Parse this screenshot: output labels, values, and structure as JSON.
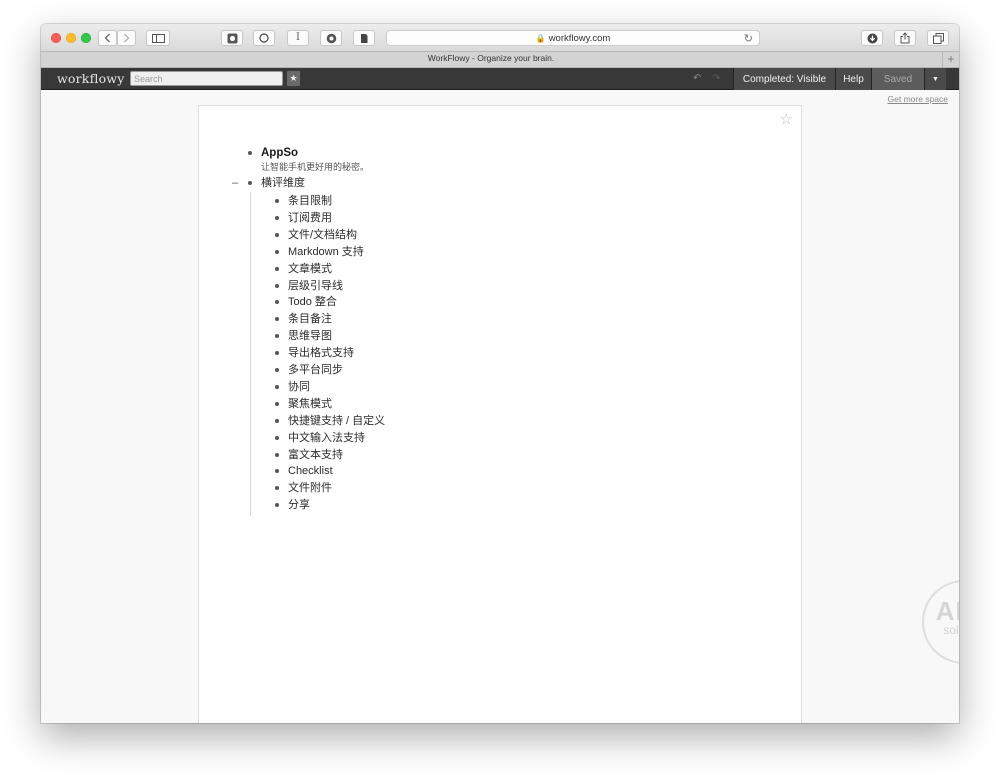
{
  "browser": {
    "url": "workflowy.com",
    "tab_title": "WorkFlowy - Organize your brain."
  },
  "workflowy": {
    "logo": "workflowy",
    "search_placeholder": "Search",
    "completed_label": "Completed: Visible",
    "help_label": "Help",
    "saved_label": "Saved",
    "more_space_link": "Get more space"
  },
  "outline": {
    "root_title": "AppSo",
    "root_note": "让智能手机更好用的秘密。",
    "group_title": "横评维度",
    "children": [
      "条目限制",
      "订阅费用",
      "文件/文档结构",
      "Markdown 支持",
      "文章模式",
      "层级引导线",
      "Todo 整合",
      "条目备注",
      "思维导图",
      "导出格式支持",
      "多平台同步",
      "协同",
      "聚焦模式",
      "快捷键支持 / 自定义",
      "中文输入法支持",
      "富文本支持",
      "Checklist",
      "文件附件",
      "分享"
    ]
  },
  "watermark": {
    "line1": "APP",
    "line2": "solution"
  }
}
